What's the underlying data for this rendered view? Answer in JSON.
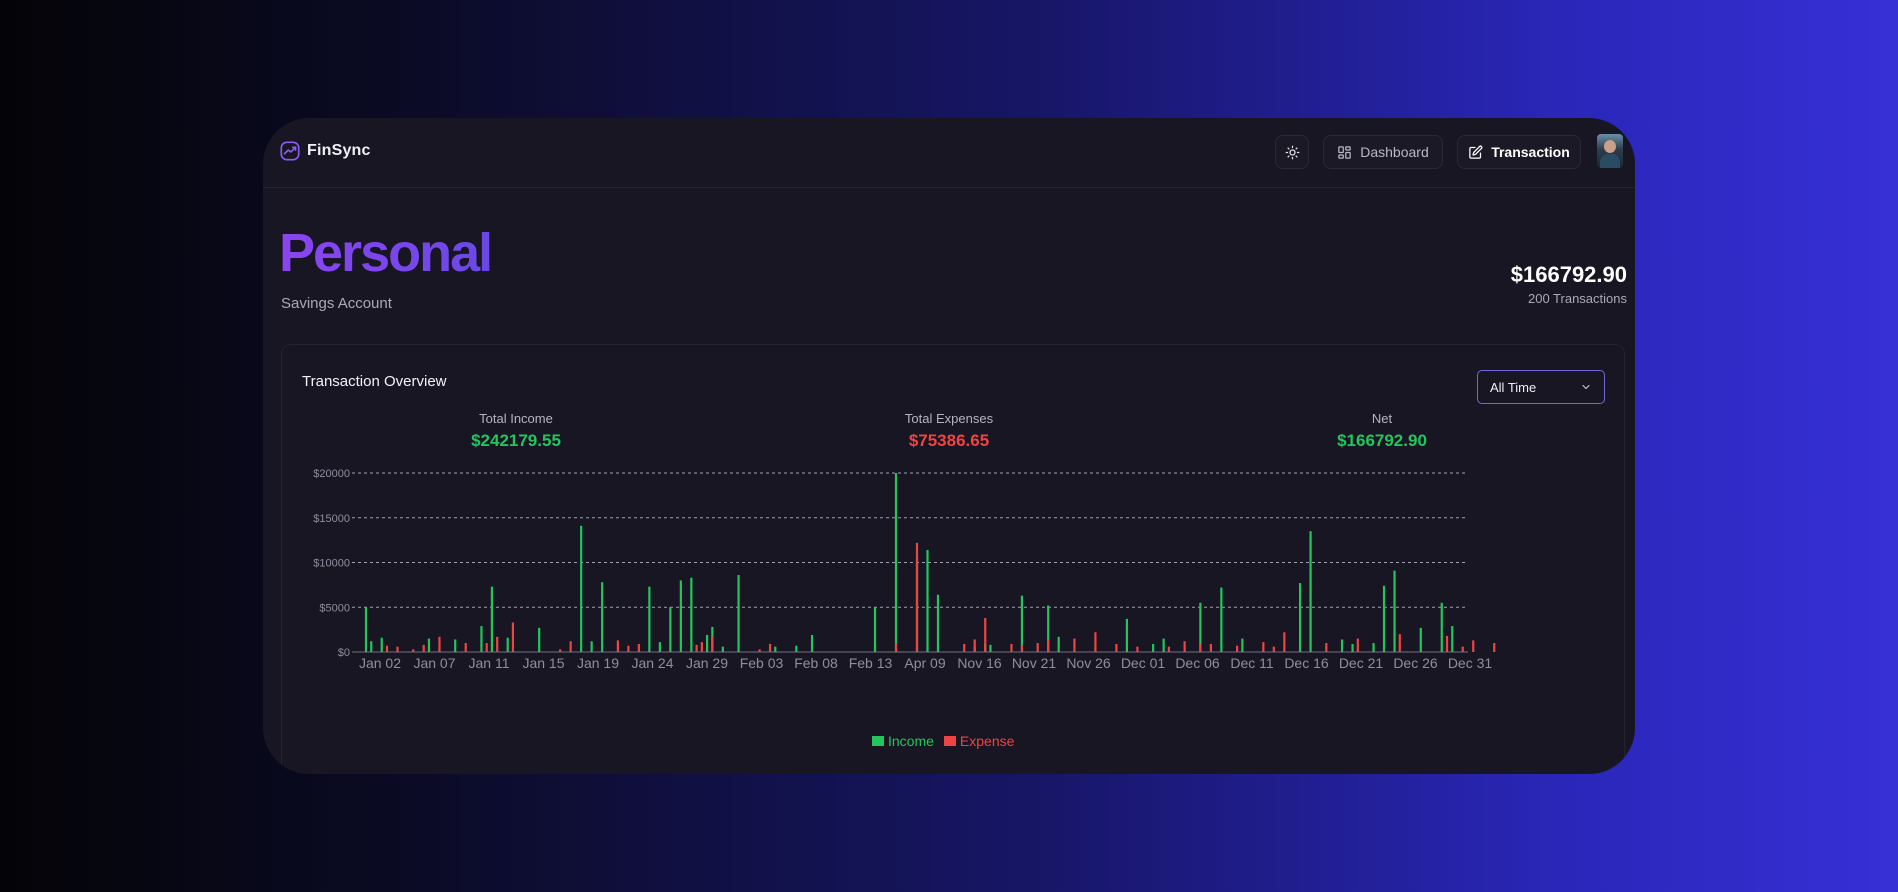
{
  "app": {
    "name": "FinSync"
  },
  "nav": {
    "theme_icon": "sun-icon",
    "dashboard_label": "Dashboard",
    "transaction_label": "Transaction"
  },
  "account": {
    "title": "Personal",
    "subtitle": "Savings Account",
    "balance": "$166792.90",
    "transactions": "200 Transactions"
  },
  "overview": {
    "title": "Transaction Overview",
    "filter": {
      "selected": "All Time"
    },
    "stats": [
      {
        "label": "Total Income",
        "value": "$242179.55"
      },
      {
        "label": "Total Expenses",
        "value": "$75386.65"
      },
      {
        "label": "Net",
        "value": "$166792.90"
      }
    ]
  },
  "colors": {
    "accent": "#7c3aed",
    "income": "#22c55e",
    "expense": "#ef4444"
  },
  "chart_data": {
    "type": "bar",
    "x_tick_labels": [
      "Jan 02",
      "Jan 07",
      "Jan 11",
      "Jan 15",
      "Jan 19",
      "Jan 24",
      "Jan 29",
      "Feb 03",
      "Feb 08",
      "Feb 13",
      "Apr 09",
      "Nov 16",
      "Nov 21",
      "Nov 26",
      "Dec 01",
      "Dec 06",
      "Dec 11",
      "Dec 16",
      "Dec 21",
      "Dec 26",
      "Dec 31"
    ],
    "y_ticks": [
      "$0",
      "$5000",
      "$10000",
      "$15000",
      "$20000"
    ],
    "ylim": [
      0,
      20000
    ],
    "grid": true,
    "legend_position": "bottom",
    "series": [
      {
        "name": "Income",
        "color": "#22c55e",
        "values": [
          5000,
          1200,
          0,
          1600,
          0,
          0,
          0,
          0,
          0,
          0,
          0,
          0,
          1500,
          0,
          0,
          0,
          0,
          1400,
          0,
          0,
          0,
          0,
          2900,
          0,
          7300,
          0,
          0,
          1600,
          0,
          0,
          0,
          0,
          0,
          2700,
          0,
          0,
          0,
          0,
          0,
          0,
          0,
          14100,
          0,
          1200,
          0,
          7800,
          0,
          0,
          0,
          0,
          0,
          0,
          0,
          0,
          7300,
          0,
          1100,
          0,
          5000,
          0,
          8000,
          0,
          8300,
          0,
          0,
          1900,
          2800,
          0,
          600,
          0,
          0,
          8600,
          0,
          0,
          0,
          0,
          0,
          0,
          600,
          0,
          0,
          0,
          700,
          0,
          0,
          1900,
          0,
          0,
          0,
          0,
          0,
          0,
          0,
          0,
          0,
          0,
          0,
          5000,
          0,
          0,
          0,
          20000,
          0,
          0,
          0,
          10600,
          0,
          11400,
          0,
          6400,
          0,
          0,
          0,
          0,
          0,
          0,
          600,
          0,
          900,
          800,
          0,
          0,
          0,
          0,
          0,
          6300,
          0,
          0,
          0,
          0,
          5200,
          0,
          1700,
          0,
          0,
          0,
          0,
          0,
          0,
          0,
          0,
          0,
          0,
          0,
          0,
          3700,
          0,
          0,
          0,
          0,
          900,
          0,
          1500,
          0,
          0,
          0,
          0,
          0,
          0,
          5500,
          0,
          0,
          0,
          7200,
          0,
          0,
          0,
          1500,
          0,
          0,
          0,
          0,
          0,
          0,
          0,
          0,
          0,
          0,
          7700,
          0,
          13500,
          0,
          0,
          0,
          0,
          0,
          1400,
          0,
          900,
          0,
          0,
          0,
          1000,
          0,
          7400,
          0,
          9100,
          0,
          0,
          0,
          0,
          2700,
          0,
          0,
          0,
          5500,
          0,
          2900,
          0,
          0,
          0
        ]
      },
      {
        "name": "Expense",
        "color": "#ef4444",
        "values": [
          0,
          0,
          0,
          0,
          700,
          0,
          600,
          0,
          0,
          300,
          0,
          800,
          0,
          0,
          1700,
          0,
          0,
          0,
          0,
          1000,
          0,
          0,
          0,
          1000,
          0,
          1700,
          0,
          0,
          3300,
          0,
          0,
          0,
          0,
          0,
          0,
          0,
          0,
          300,
          0,
          1200,
          0,
          0,
          0,
          0,
          0,
          0,
          0,
          0,
          1300,
          0,
          700,
          0,
          900,
          0,
          0,
          0,
          0,
          0,
          0,
          0,
          0,
          0,
          0,
          800,
          1100,
          0,
          1700,
          0,
          0,
          0,
          0,
          0,
          0,
          0,
          0,
          300,
          0,
          900,
          0,
          0,
          0,
          0,
          0,
          0,
          0,
          0,
          0,
          0,
          0,
          0,
          0,
          0,
          0,
          0,
          0,
          0,
          0,
          0,
          0,
          0,
          0,
          1000,
          0,
          0,
          0,
          12200,
          0,
          0,
          0,
          0,
          0,
          0,
          0,
          0,
          900,
          0,
          1400,
          0,
          3800,
          0,
          0,
          0,
          0,
          900,
          0,
          800,
          0,
          0,
          1000,
          0,
          1400,
          0,
          0,
          0,
          0,
          1500,
          0,
          0,
          0,
          2200,
          0,
          0,
          0,
          900,
          0,
          0,
          0,
          600,
          0,
          0,
          0,
          0,
          0,
          600,
          0,
          0,
          1200,
          0,
          0,
          900,
          0,
          900,
          0,
          0,
          0,
          0,
          700,
          0,
          0,
          0,
          0,
          1100,
          0,
          600,
          0,
          2200,
          0,
          0,
          0,
          0,
          0,
          0,
          0,
          1000,
          0,
          0,
          0,
          0,
          0,
          1500,
          0,
          0,
          0,
          0,
          0,
          0,
          0,
          2000,
          0,
          0,
          0,
          0,
          0,
          0,
          0,
          0,
          1800,
          0,
          0,
          600,
          0,
          1300,
          0,
          0,
          0,
          1000
        ]
      }
    ]
  },
  "legend": {
    "income": "Income",
    "expense": "Expense"
  }
}
